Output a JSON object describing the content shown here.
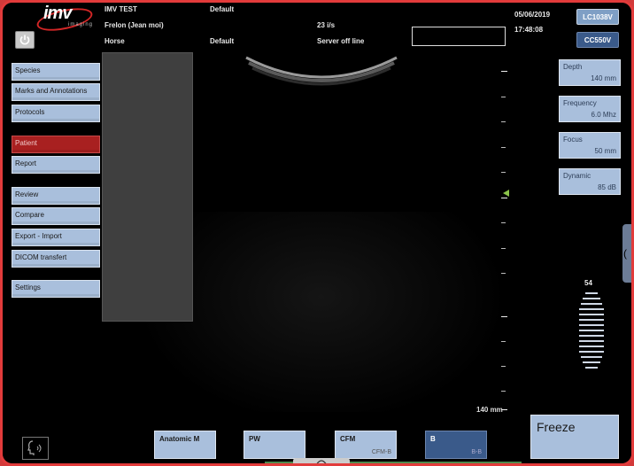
{
  "header": {
    "logo_word": "imv",
    "logo_sub": "imaging",
    "patient_name": "IMV TEST",
    "operator": "Frelon (Jean moi)",
    "species": "Horse",
    "preset_top": "Default",
    "preset_bottom": "Default",
    "frame_rate": "23 i/s",
    "server_status": "Server off line",
    "date": "05/06/2019",
    "time": "17:48:08",
    "probe_active": "LC1038V",
    "probe_other": "CC550V"
  },
  "menu": {
    "items": [
      {
        "label": "Species"
      },
      {
        "label": "Marks and Annotations"
      },
      {
        "label": "Protocols"
      },
      {
        "label": "Patient"
      },
      {
        "label": "Report"
      },
      {
        "label": "Review"
      },
      {
        "label": "Compare"
      },
      {
        "label": "Export - Import"
      },
      {
        "label": "DICOM transfert"
      },
      {
        "label": "Settings"
      }
    ]
  },
  "params": {
    "depth": {
      "label": "Depth",
      "value": "140 mm"
    },
    "frequency": {
      "label": "Frequency",
      "value": "6.0 Mhz"
    },
    "focus": {
      "label": "Focus",
      "value": "50 mm"
    },
    "dynamic": {
      "label": "Dynamic",
      "value": "85 dB"
    }
  },
  "image": {
    "depth_label": "140 mm",
    "gain": "54"
  },
  "modes": {
    "anatomic_m": {
      "label": "Anatomic M"
    },
    "pw": {
      "label": "PW"
    },
    "cfm": {
      "label": "CFM",
      "sub": "CFM-B"
    },
    "b": {
      "label": "B",
      "sub": "B-B"
    }
  },
  "freeze_label": "Freeze",
  "colors": {
    "frame": "#e23b3b",
    "button": "#a9bfdc",
    "active_mode": "#3a5a8a",
    "active_menu": "#a82020",
    "focus_marker": "#8bc34a"
  },
  "icons": [
    "power-icon",
    "voice-icon",
    "sector-probe-icon"
  ]
}
